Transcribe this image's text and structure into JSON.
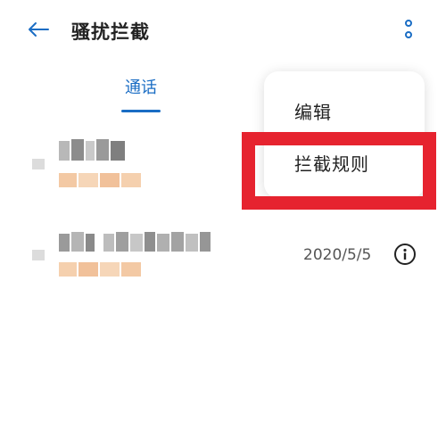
{
  "header": {
    "title": "骚扰拦截",
    "back_icon": "back-arrow-icon",
    "more_icon": "more-vertical-icon"
  },
  "tabs": [
    {
      "label": "通话",
      "active": true
    }
  ],
  "list": [
    {
      "date": ""
    },
    {
      "date": "2020/5/5",
      "info_icon": "info-icon"
    }
  ],
  "menu": {
    "items": [
      {
        "label": "编辑"
      },
      {
        "label": "拦截规则"
      }
    ]
  },
  "colors": {
    "accent": "#1a6dc4",
    "highlight": "#e6232f",
    "tag_pixels": "#f3c9a4"
  }
}
